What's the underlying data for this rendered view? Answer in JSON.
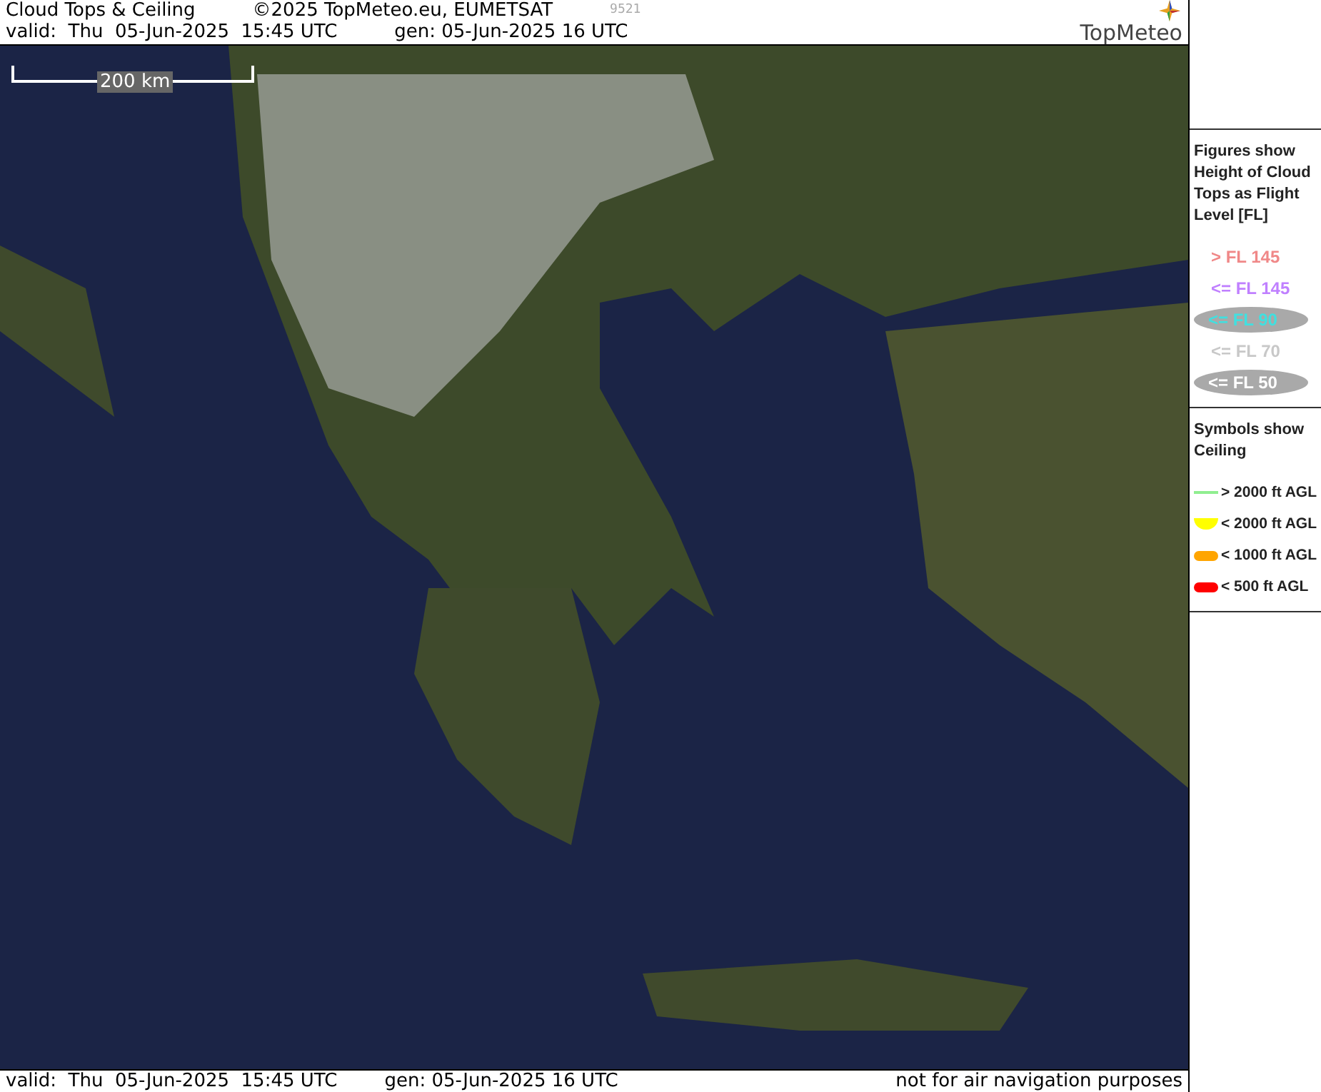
{
  "header": {
    "title": "Cloud Tops & Ceiling",
    "copyright": "©2025 TopMeteo.eu, EUMETSAT",
    "code": "9521",
    "valid": "valid:  Thu  05-Jun-2025  15:45 UTC",
    "generated": "gen: 05-Jun-2025 16 UTC",
    "logo": "TopMeteo"
  },
  "map": {
    "scale": "200 km"
  },
  "legend": {
    "heights_title": "Figures show Height of Cloud Tops as Flight Level  [FL]",
    "heights": [
      {
        "label": "> FL 145",
        "color": "#f08888",
        "kind": "plain"
      },
      {
        "label": "<= FL 145",
        "color": "#c080ff",
        "kind": "plain"
      },
      {
        "label": "<= FL 90",
        "color": "#40e0e0",
        "kind": "pill"
      },
      {
        "label": "<= FL 70",
        "color": "#c8c8c8",
        "kind": "plain"
      },
      {
        "label": "<= FL 50",
        "color": "#ffffff",
        "kind": "pill"
      }
    ],
    "symbols_title": "Symbols show Ceiling",
    "symbols": [
      {
        "label": "> 2000 ft AGL",
        "color": "#90ee90",
        "kind": "line"
      },
      {
        "label": "< 2000 ft AGL",
        "color": "#ffff00",
        "kind": "half"
      },
      {
        "label": "< 1000 ft AGL",
        "color": "#ffa500",
        "kind": "pill"
      },
      {
        "label": "< 500 ft AGL",
        "color": "#ff0000",
        "kind": "pill"
      }
    ]
  },
  "footer": {
    "valid": "valid:  Thu  05-Jun-2025  15:45 UTC",
    "generated": "gen: 05-Jun-2025 16 UTC",
    "note": "not for air navigation purposes"
  }
}
